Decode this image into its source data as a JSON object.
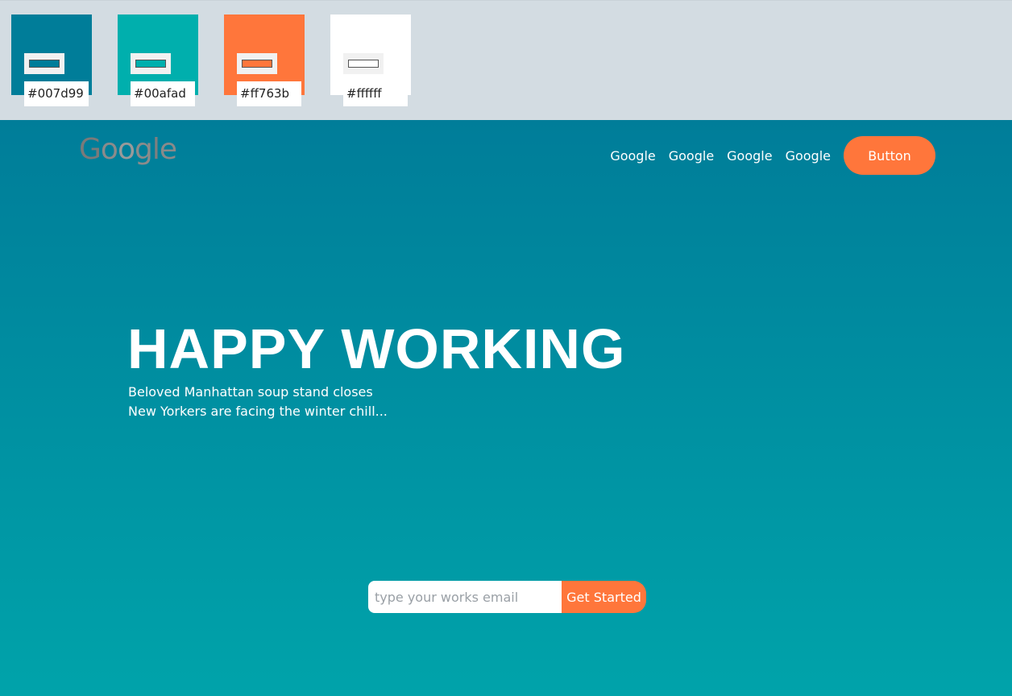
{
  "palette": [
    {
      "hex": "#007d99"
    },
    {
      "hex": "#00afad"
    },
    {
      "hex": "#ff763b"
    },
    {
      "hex": "#ffffff"
    }
  ],
  "header": {
    "logo_letters": [
      "G",
      "o",
      "o",
      "g",
      "l",
      "e"
    ],
    "nav_links": [
      "Google",
      "Google",
      "Google",
      "Google"
    ],
    "cta_label": "Button"
  },
  "hero": {
    "headline": "HAPPY WORKING",
    "subline_1": "Beloved Manhattan soup stand closes",
    "subline_2": "New Yorkers are facing the winter chill..."
  },
  "signup": {
    "email_placeholder": "type your works email",
    "submit_label": "Get Started"
  },
  "colors": {
    "primary": "#007d99",
    "secondary": "#00afad",
    "accent": "#ff763b",
    "light": "#ffffff"
  }
}
